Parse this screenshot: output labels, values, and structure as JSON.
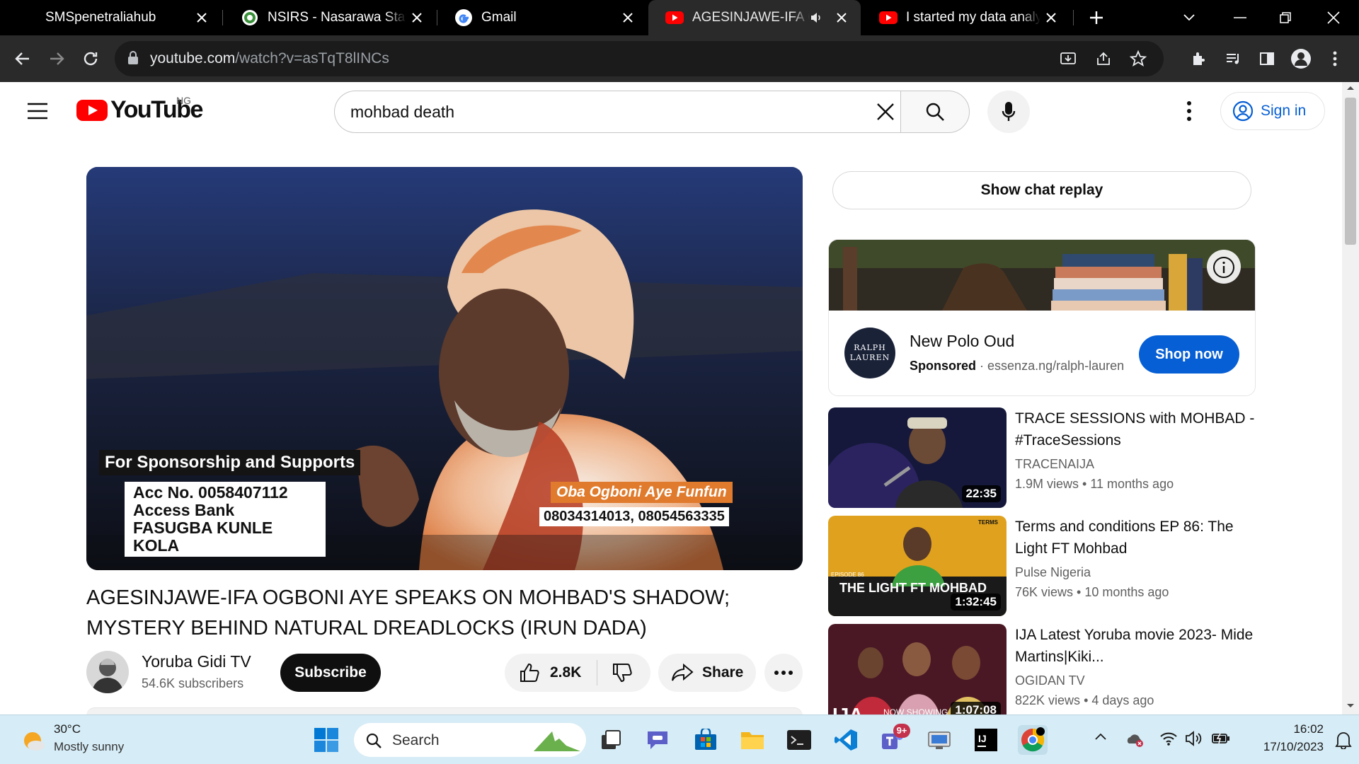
{
  "browser": {
    "tabs": [
      {
        "title": "SMSpenetraliahub",
        "icon": "blank-favicon",
        "active": false
      },
      {
        "title": "NSIRS - Nasarawa State I",
        "icon": "nsirs-favicon",
        "active": false
      },
      {
        "title": "Gmail",
        "icon": "google-favicon",
        "active": false
      },
      {
        "title": "AGESINJAWE-IFA OG",
        "icon": "youtube-favicon",
        "active": true,
        "audio": true
      },
      {
        "title": "I started my data analyst",
        "icon": "youtube-favicon",
        "active": false
      }
    ],
    "url_host": "youtube.com",
    "url_path": "/watch?v=asTqT8lINCs"
  },
  "youtube": {
    "logo_text": "YouTube",
    "country": "NG",
    "search_value": "mohbad death",
    "sign_in": "Sign in",
    "video": {
      "overlay_sponsor_heading": "For Sponsorship and Supports",
      "overlay_acc": "Acc No. 0058407112",
      "overlay_bank": "Access Bank",
      "overlay_name": "FASUGBA KUNLE KOLA",
      "overlay_speaker": "Oba Ogboni Aye Funfun",
      "overlay_phones": "08034314013, 08054563335"
    },
    "title": "AGESINJAWE-IFA OGBONI AYE SPEAKS ON MOHBAD'S SHADOW; MYSTERY BEHIND NATURAL DREADLOCKS (IRUN DADA)",
    "channel": {
      "name": "Yoruba Gidi TV",
      "subscribers": "54.6K subscribers",
      "subscribe_label": "Subscribe"
    },
    "actions": {
      "likes": "2.8K",
      "share": "Share"
    },
    "chat_replay": "Show chat replay",
    "ad": {
      "brand_logo_line1": "RALPH",
      "brand_logo_line2": "LAUREN",
      "title": "New Polo Oud",
      "sponsored": "Sponsored",
      "domain": "essenza.ng/ralph-lauren",
      "cta": "Shop now"
    },
    "recommendations": [
      {
        "title": "TRACE SESSIONS with MOHBAD - #TraceSessions",
        "channel": "TRACENAIJA",
        "views": "1.9M views",
        "age": "11 months ago",
        "duration": "22:35",
        "thumb_text": ""
      },
      {
        "title": "Terms and conditions EP 86: The Light FT Mohbad",
        "channel": "Pulse Nigeria",
        "views": "76K views",
        "age": "10 months ago",
        "duration": "1:32:45",
        "thumb_text": "THE LIGHT FT MOHBAD"
      },
      {
        "title": "IJA Latest Yoruba movie 2023- Mide Martins|Kiki...",
        "channel": "OGIDAN TV",
        "views": "822K views",
        "age": "4 days ago",
        "duration": "1:07:08",
        "thumb_text": "NOW SHOWING"
      }
    ]
  },
  "taskbar": {
    "weather_temp": "30°C",
    "weather_desc": "Mostly sunny",
    "search_placeholder": "Search",
    "teams_badge": "9+",
    "time": "16:02",
    "date": "17/10/2023"
  },
  "colors": {
    "youtube_red": "#ff0000",
    "link_blue": "#065fd4",
    "shop_button": "#065fd4",
    "tab_strip": "#000000",
    "toolbar": "#2a2a2a",
    "taskbar": "#d6ecf6"
  }
}
